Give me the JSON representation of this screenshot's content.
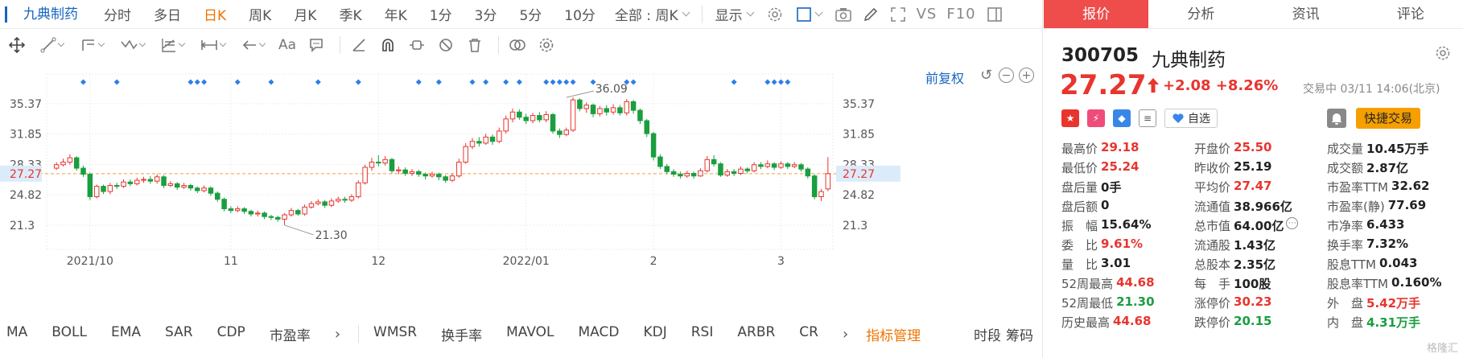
{
  "toolbar": {
    "stock_name": "九典制药",
    "periods": [
      "分时",
      "多日",
      "日K",
      "周K",
      "月K",
      "季K",
      "年K",
      "1分",
      "3分",
      "5分",
      "10分"
    ],
    "active_period": "日K",
    "range_dropdown": "全部 : 周K",
    "display_label": "显示",
    "vs_label": "VS",
    "f10_label": "F10"
  },
  "tools": {
    "text_tool": "Aa"
  },
  "chart_controls": {
    "restore_label": "前复权"
  },
  "chart_data": {
    "type": "candlestick",
    "xlabels": [
      {
        "label": "2021/10",
        "idx": 5
      },
      {
        "label": "11",
        "idx": 26
      },
      {
        "label": "12",
        "idx": 48
      },
      {
        "label": "2022/01",
        "idx": 70
      },
      {
        "label": "2",
        "idx": 89
      },
      {
        "label": "3",
        "idx": 108
      }
    ],
    "yticks": [
      35.37,
      31.85,
      28.33,
      27.27,
      24.82,
      21.3
    ],
    "ylim": [
      18.5,
      38.8
    ],
    "current_price": 27.27,
    "max_label": "36.09",
    "min_label": "21.30",
    "max_idx": 76,
    "min_idx": 34,
    "signal_idx": [
      4,
      9,
      20,
      21,
      22,
      27,
      32,
      39,
      45,
      54,
      57,
      62,
      64,
      67,
      69,
      73,
      74,
      75,
      76,
      77,
      80,
      85,
      86,
      101,
      106,
      107,
      108,
      109
    ],
    "candles": [
      [
        27.9,
        28.3,
        27.7,
        28.6
      ],
      [
        28.3,
        28.6,
        28.1,
        29.0
      ],
      [
        28.6,
        29.1,
        28.3,
        29.5
      ],
      [
        29.1,
        27.9,
        27.6,
        29.3
      ],
      [
        27.9,
        27.2,
        26.9,
        28.2
      ],
      [
        27.2,
        24.6,
        24.2,
        27.4
      ],
      [
        24.6,
        25.8,
        24.4,
        26.0
      ],
      [
        25.8,
        25.2,
        24.9,
        26.0
      ],
      [
        25.2,
        25.9,
        24.9,
        26.2
      ],
      [
        25.9,
        25.8,
        25.5,
        26.2
      ],
      [
        25.8,
        26.3,
        25.6,
        26.6
      ],
      [
        26.3,
        26.1,
        25.8,
        26.6
      ],
      [
        26.1,
        26.5,
        25.9,
        26.8
      ],
      [
        26.5,
        26.6,
        26.2,
        26.9
      ],
      [
        26.6,
        26.4,
        26.1,
        27.0
      ],
      [
        26.4,
        26.9,
        26.1,
        27.2
      ],
      [
        26.9,
        25.9,
        25.6,
        27.1
      ],
      [
        25.9,
        26.1,
        25.7,
        26.4
      ],
      [
        26.1,
        25.7,
        25.4,
        26.3
      ],
      [
        25.7,
        25.9,
        25.5,
        26.2
      ],
      [
        25.9,
        25.6,
        25.3,
        26.1
      ],
      [
        25.6,
        25.3,
        25.0,
        25.8
      ],
      [
        25.3,
        25.6,
        25.1,
        25.9
      ],
      [
        25.6,
        25.0,
        24.7,
        25.8
      ],
      [
        25.0,
        24.3,
        24.0,
        25.2
      ],
      [
        24.3,
        23.2,
        22.9,
        24.5
      ],
      [
        23.2,
        23.0,
        22.7,
        23.5
      ],
      [
        23.0,
        23.2,
        22.8,
        23.5
      ],
      [
        23.2,
        22.9,
        22.6,
        23.4
      ],
      [
        22.9,
        22.6,
        22.3,
        23.1
      ],
      [
        22.6,
        22.7,
        22.3,
        23.0
      ],
      [
        22.7,
        22.3,
        22.0,
        22.9
      ],
      [
        22.3,
        22.2,
        21.9,
        22.5
      ],
      [
        22.2,
        22.0,
        21.7,
        22.4
      ],
      [
        22.0,
        22.5,
        21.3,
        22.7
      ],
      [
        22.5,
        23.0,
        22.3,
        23.3
      ],
      [
        23.0,
        22.6,
        22.4,
        23.2
      ],
      [
        22.6,
        23.4,
        22.4,
        23.7
      ],
      [
        23.4,
        23.8,
        23.2,
        24.1
      ],
      [
        23.8,
        24.0,
        23.6,
        24.3
      ],
      [
        24.0,
        23.6,
        23.3,
        24.2
      ],
      [
        23.6,
        24.1,
        23.4,
        24.4
      ],
      [
        24.1,
        24.3,
        23.9,
        24.6
      ],
      [
        24.3,
        24.2,
        23.9,
        24.6
      ],
      [
        24.2,
        24.6,
        24.0,
        24.9
      ],
      [
        24.6,
        26.2,
        24.4,
        26.5
      ],
      [
        26.2,
        28.0,
        26.0,
        28.3
      ],
      [
        28.0,
        28.6,
        27.6,
        29.1
      ],
      [
        28.6,
        28.5,
        28.1,
        29.4
      ],
      [
        28.5,
        28.9,
        28.2,
        29.3
      ],
      [
        28.9,
        27.6,
        27.3,
        29.1
      ],
      [
        27.6,
        27.7,
        27.2,
        28.1
      ],
      [
        27.7,
        27.3,
        27.0,
        28.0
      ],
      [
        27.3,
        27.5,
        27.0,
        27.8
      ],
      [
        27.5,
        27.2,
        26.9,
        27.7
      ],
      [
        27.2,
        27.0,
        26.6,
        27.4
      ],
      [
        27.0,
        27.2,
        26.8,
        27.5
      ],
      [
        27.2,
        26.9,
        26.5,
        27.4
      ],
      [
        26.9,
        26.5,
        26.2,
        27.1
      ],
      [
        26.5,
        27.0,
        26.3,
        27.3
      ],
      [
        27.0,
        28.6,
        26.8,
        29.0
      ],
      [
        28.6,
        30.4,
        28.4,
        30.8
      ],
      [
        30.4,
        31.0,
        30.1,
        31.4
      ],
      [
        31.0,
        30.8,
        30.4,
        31.5
      ],
      [
        30.8,
        31.5,
        30.6,
        31.9
      ],
      [
        31.5,
        31.0,
        30.6,
        31.8
      ],
      [
        31.0,
        32.2,
        30.8,
        32.6
      ],
      [
        32.2,
        33.6,
        31.9,
        34.0
      ],
      [
        33.6,
        34.4,
        33.2,
        34.8
      ],
      [
        34.4,
        33.8,
        33.5,
        34.7
      ],
      [
        33.8,
        33.4,
        33.0,
        34.2
      ],
      [
        33.4,
        34.0,
        33.1,
        34.3
      ],
      [
        34.0,
        33.5,
        33.2,
        34.4
      ],
      [
        33.5,
        34.1,
        33.2,
        34.5
      ],
      [
        34.1,
        32.2,
        31.9,
        34.3
      ],
      [
        32.2,
        31.8,
        31.4,
        32.5
      ],
      [
        31.8,
        32.3,
        31.6,
        32.6
      ],
      [
        32.3,
        35.8,
        32.1,
        36.09
      ],
      [
        35.8,
        34.8,
        34.5,
        36.0
      ],
      [
        34.8,
        35.2,
        34.3,
        35.5
      ],
      [
        35.2,
        34.2,
        33.8,
        35.4
      ],
      [
        34.2,
        34.8,
        33.9,
        35.1
      ],
      [
        34.8,
        34.4,
        34.0,
        35.2
      ],
      [
        34.4,
        34.9,
        34.1,
        35.3
      ],
      [
        34.9,
        34.3,
        34.0,
        35.2
      ],
      [
        34.3,
        35.6,
        34.0,
        35.9
      ],
      [
        35.6,
        34.6,
        34.2,
        35.8
      ],
      [
        34.6,
        33.4,
        33.0,
        34.8
      ],
      [
        33.4,
        31.9,
        31.5,
        33.6
      ],
      [
        31.9,
        29.2,
        28.8,
        32.1
      ],
      [
        29.2,
        28.1,
        27.8,
        29.5
      ],
      [
        28.1,
        27.5,
        27.2,
        28.4
      ],
      [
        27.5,
        27.2,
        26.9,
        27.8
      ],
      [
        27.2,
        27.0,
        26.7,
        27.5
      ],
      [
        27.0,
        27.3,
        26.8,
        27.6
      ],
      [
        27.3,
        27.0,
        26.7,
        27.5
      ],
      [
        27.0,
        27.6,
        26.9,
        27.9
      ],
      [
        27.6,
        28.9,
        27.4,
        29.3
      ],
      [
        28.9,
        28.4,
        28.1,
        29.4
      ],
      [
        28.4,
        27.1,
        26.9,
        28.6
      ],
      [
        27.1,
        27.5,
        26.9,
        27.8
      ],
      [
        27.5,
        27.3,
        27.0,
        27.8
      ],
      [
        27.3,
        27.8,
        27.1,
        28.1
      ],
      [
        27.8,
        27.6,
        27.3,
        28.0
      ],
      [
        27.6,
        28.3,
        27.4,
        28.6
      ],
      [
        28.3,
        28.1,
        27.8,
        28.6
      ],
      [
        28.1,
        28.4,
        27.9,
        28.8
      ],
      [
        28.4,
        28.0,
        27.7,
        28.6
      ],
      [
        28.0,
        28.4,
        27.8,
        28.7
      ],
      [
        28.4,
        28.1,
        27.8,
        28.6
      ],
      [
        28.1,
        28.3,
        27.9,
        28.6
      ],
      [
        28.3,
        27.8,
        27.5,
        28.5
      ],
      [
        27.8,
        27.0,
        26.7,
        28.0
      ],
      [
        27.0,
        24.6,
        24.3,
        27.2
      ],
      [
        24.6,
        25.19,
        24.1,
        25.5
      ],
      [
        25.5,
        27.27,
        25.24,
        29.18
      ]
    ]
  },
  "indicators": {
    "items": [
      "MA",
      "BOLL",
      "EMA",
      "SAR",
      "CDP",
      "市盈率"
    ],
    "items2": [
      "WMSR",
      "换手率",
      "MAVOL",
      "MACD",
      "KDJ",
      "RSI",
      "ARBR",
      "CR"
    ],
    "manage": "指标管理",
    "right1": "时段",
    "right2": "筹码"
  },
  "right_tabs": [
    "报价",
    "分析",
    "资讯",
    "评论"
  ],
  "quote": {
    "code": "300705",
    "name": "九典制药",
    "price": "27.27",
    "change": "+2.08",
    "change_pct": "+8.26%",
    "status": "交易中 03/11 14:06(北京)",
    "zixuan_label": "自选",
    "quick_trade": "快捷交易",
    "rows": [
      [
        [
          "最高价",
          "29.18",
          "red"
        ],
        [
          "开盘价",
          "25.50",
          "red"
        ],
        [
          "成交量",
          "10.45万手",
          ""
        ]
      ],
      [
        [
          "最低价",
          "25.24",
          "red"
        ],
        [
          "昨收价",
          "25.19",
          ""
        ],
        [
          "成交额",
          "2.87亿",
          ""
        ]
      ],
      [
        [
          "盘后量",
          "0手",
          ""
        ],
        [
          "平均价",
          "27.47",
          "red"
        ],
        [
          "市盈率TTM",
          "32.62",
          ""
        ]
      ],
      [
        [
          "盘后额",
          "0",
          ""
        ],
        [
          "流通值",
          "38.966亿",
          ""
        ],
        [
          "市盈率(静)",
          "77.69",
          ""
        ]
      ],
      [
        [
          "振　幅",
          "15.64%",
          ""
        ],
        [
          "总市值",
          "64.00亿",
          "q"
        ],
        [
          "市净率",
          "6.433",
          ""
        ]
      ],
      [
        [
          "委　比",
          "9.61%",
          "red"
        ],
        [
          "流通股",
          "1.43亿",
          ""
        ],
        [
          "换手率",
          "7.32%",
          ""
        ]
      ],
      [
        [
          "量　比",
          "3.01",
          ""
        ],
        [
          "总股本",
          "2.35亿",
          ""
        ],
        [
          "股息TTM",
          "0.043",
          ""
        ]
      ],
      [
        [
          "52周最高",
          "44.68",
          "red"
        ],
        [
          "每　手",
          "100股",
          ""
        ],
        [
          "股息率TTM",
          "0.160%",
          ""
        ]
      ],
      [
        [
          "52周最低",
          "21.30",
          "green"
        ],
        [
          "涨停价",
          "30.23",
          "red"
        ],
        [
          "外　盘",
          "5.42万手",
          "red"
        ]
      ],
      [
        [
          "历史最高",
          "44.68",
          "red"
        ],
        [
          "跌停价",
          "20.15",
          "green"
        ],
        [
          "内　盘",
          "4.31万手",
          "green"
        ]
      ]
    ]
  },
  "colors": {
    "up": "#e8352e",
    "down": "#1a9e3f",
    "accent": "#1565c0",
    "signal": "#2f7ee8",
    "tab_active": "#ef4c4c"
  }
}
